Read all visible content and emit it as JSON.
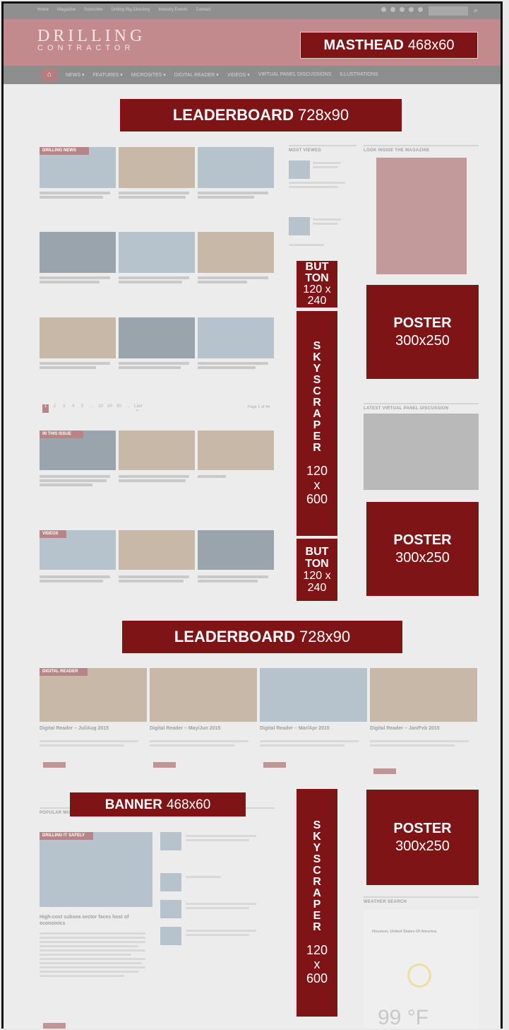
{
  "site": {
    "logo_line1": "DRILLING",
    "logo_line2": "CONTRACTOR",
    "topbar_links": [
      "Home",
      "Magazine",
      "Subscribe",
      "Drilling Rig Directory",
      "Industry Events",
      "Contact"
    ],
    "nav_items": [
      "NEWS ▾",
      "FEATURES ▾",
      "MICROSITES ▾",
      "DIGITAL READER ▾",
      "VIDEOS ▾",
      "VIRTUAL PANEL DISCUSSIONS",
      "ILLUSTRATIONS"
    ],
    "section_most_viewed": "MOST VIEWED",
    "section_look_inside": "LOOK INSIDE THE MAGAZINE",
    "section_latest_panel": "LATEST VIRTUAL PANEL DISCUSSION",
    "section_popular_microsites": "POPULAR MICROSITES",
    "section_weather": "WEATHER SEARCH",
    "tag_drilling_news": "DRILLING NEWS",
    "tag_in_this_issue": "IN THIS ISSUE",
    "tag_videos": "VIDEOS",
    "tag_digital_reader": "DIGITAL READER",
    "tag_drilling_it_safely": "DRILLING IT SAFELY",
    "pager": [
      "1",
      "2",
      "3",
      "4",
      "5",
      "...",
      "10",
      "20",
      "30",
      "...",
      "Last »"
    ],
    "pager_right": "Page 1 of 44",
    "digital_reader_titles": [
      "Digital Reader – Jul/Aug 2015",
      "Digital Reader – May/Jun 2015",
      "Digital Reader – Mar/Apr 2015",
      "Digital Reader – Jan/Feb 2015"
    ],
    "microsite_headline": "High-cost subsea sector faces host of economics",
    "weather_location": "Houston, United States Of America",
    "weather_temp": "99 °F"
  },
  "ads": {
    "masthead": {
      "name": "MASTHEAD",
      "size": "468x60"
    },
    "leaderboard_top": {
      "name": "LEADERBOARD",
      "size": "728x90"
    },
    "button_1": {
      "name_a": "BUT",
      "name_b": "TON",
      "size_a": "120 x",
      "size_b": "240"
    },
    "skyscraper_1": {
      "letters": [
        "S",
        "K",
        "Y",
        "S",
        "C",
        "R",
        "A",
        "P",
        "E",
        "R"
      ],
      "size_a": "120",
      "size_b": "x",
      "size_c": "600"
    },
    "button_2": {
      "name_a": "BUT",
      "name_b": "TON",
      "size_a": "120 x",
      "size_b": "240"
    },
    "poster_1": {
      "name": "POSTER",
      "size": "300x250"
    },
    "poster_2": {
      "name": "POSTER",
      "size": "300x250"
    },
    "leaderboard_mid": {
      "name": "LEADERBOARD",
      "size": "728x90"
    },
    "banner": {
      "name": "BANNER",
      "size": "468x60"
    },
    "skyscraper_2": {
      "letters": [
        "S",
        "K",
        "Y",
        "S",
        "C",
        "R",
        "A",
        "P",
        "E",
        "R"
      ],
      "size_a": "120",
      "size_b": "x",
      "size_c": "600"
    },
    "poster_3": {
      "name": "POSTER",
      "size": "300x250"
    }
  },
  "colors": {
    "ad_fill": "#7f1416",
    "header_tint": "#c38a8d",
    "nav_gray": "#8d8d8d",
    "page_bg": "#ececec"
  }
}
